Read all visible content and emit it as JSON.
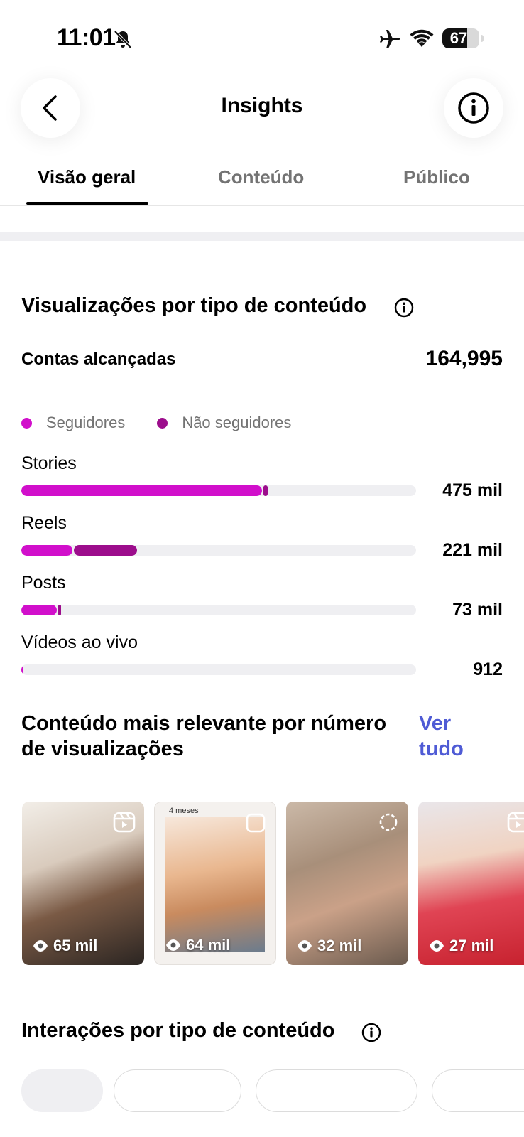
{
  "status_bar": {
    "time": "11:01",
    "battery": "67",
    "battery_level": 0.67,
    "icons": [
      "bell-slash-icon",
      "airplane-icon",
      "wifi-icon",
      "battery-icon"
    ]
  },
  "header": {
    "title": "Insights",
    "back_icon": "chevron-left-icon",
    "info_icon": "info-icon"
  },
  "tabs": [
    {
      "label": "Visão geral",
      "active": true
    },
    {
      "label": "Conteúdo",
      "active": false
    },
    {
      "label": "Público",
      "active": false
    }
  ],
  "views_by_type": {
    "title": "Visualizações por tipo de conteúdo",
    "reach_label": "Contas alcançadas",
    "reach_value": "164,995",
    "legend": [
      {
        "label": "Seguidores",
        "color": "#d10fcb"
      },
      {
        "label": "Não seguidores",
        "color": "#9c0d8c"
      }
    ],
    "rows": [
      {
        "label": "Stories",
        "value": "475 mil",
        "followers_fraction": 0.61,
        "nonfollowers_fraction": 0.01
      },
      {
        "label": "Reels",
        "value": "221 mil",
        "followers_fraction": 0.13,
        "nonfollowers_fraction": 0.16
      },
      {
        "label": "Posts",
        "value": "73 mil",
        "followers_fraction": 0.09,
        "nonfollowers_fraction": 0.005
      },
      {
        "label": "Vídeos ao vivo",
        "value": "912",
        "followers_fraction": 0.002,
        "nonfollowers_fraction": 0.0
      }
    ]
  },
  "top_content": {
    "title": "Conteúdo mais relevante por número de visualizações",
    "see_all": "Ver tudo",
    "items": [
      {
        "views": "65 mil",
        "type_icon": "reels-icon"
      },
      {
        "views": "64 mil",
        "type_icon": "post-icon",
        "caption": "4 meses"
      },
      {
        "views": "32 mil",
        "type_icon": "story-icon"
      },
      {
        "views": "27 mil",
        "type_icon": "reels-icon"
      }
    ]
  },
  "interactions": {
    "title": "Interações por tipo de conteúdo"
  }
}
